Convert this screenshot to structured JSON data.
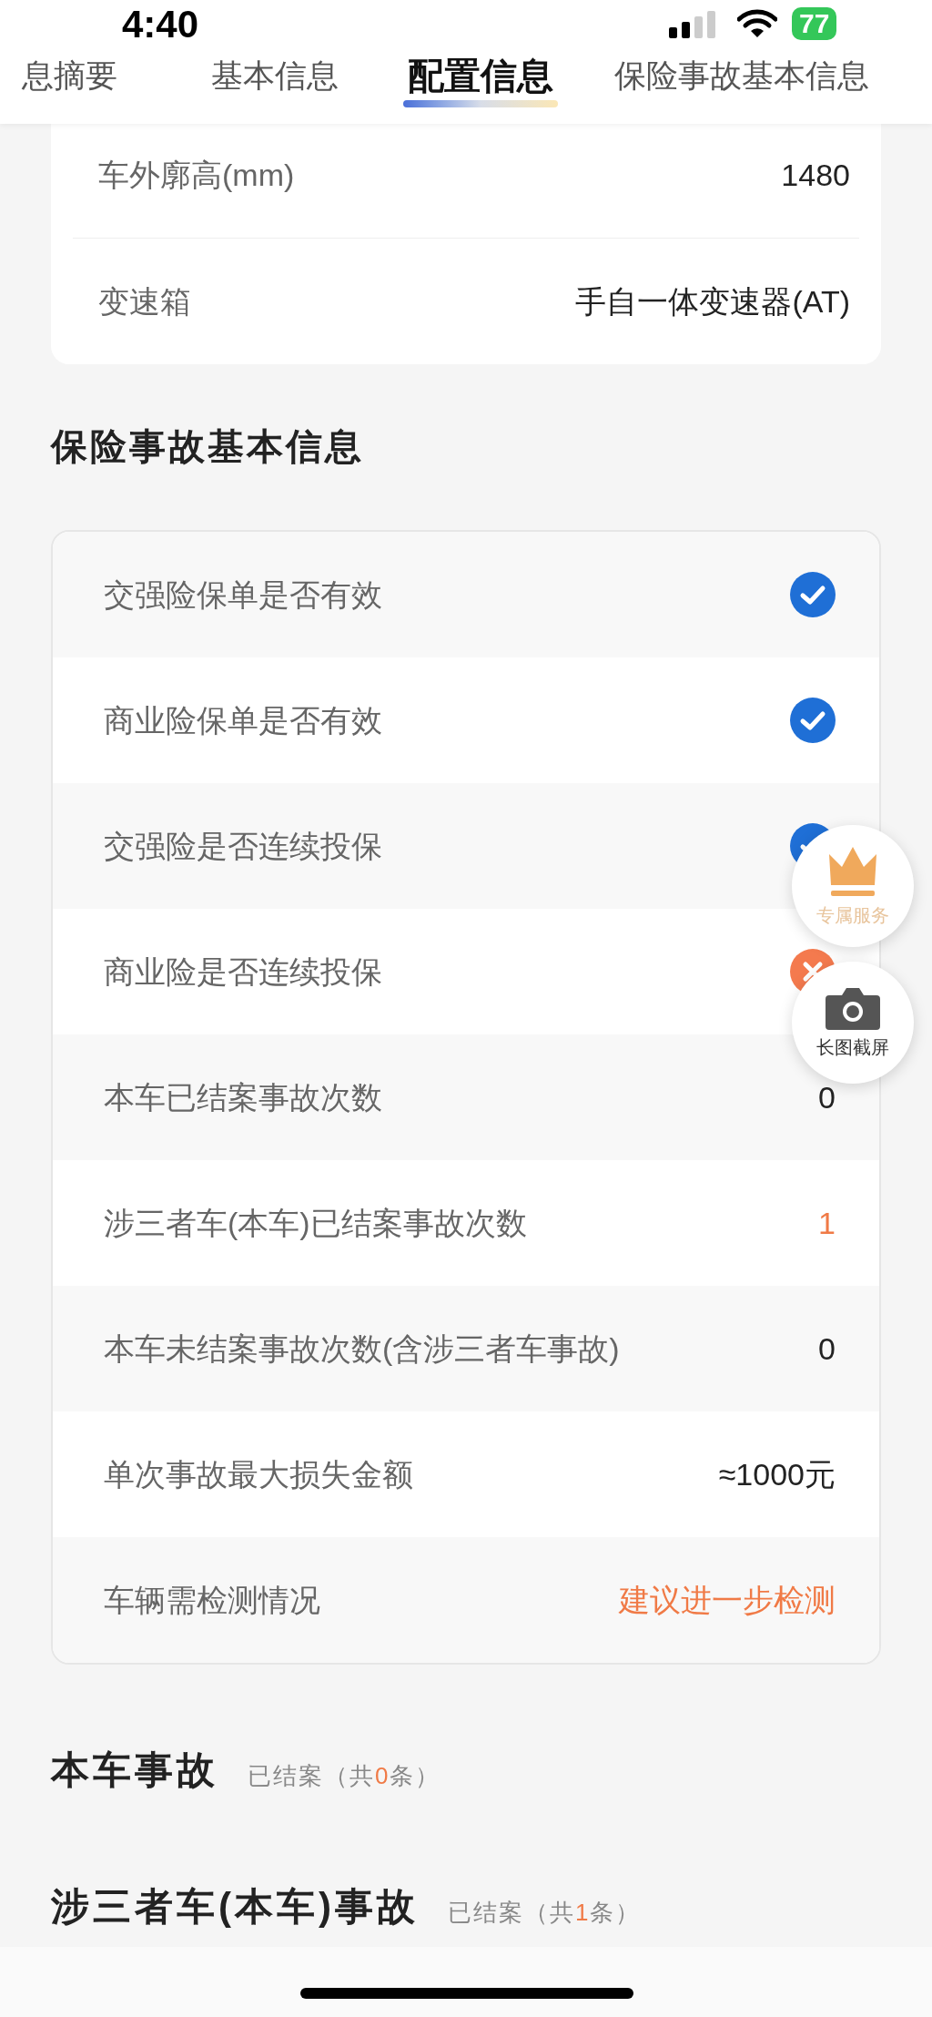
{
  "status_bar": {
    "time": "4:40",
    "battery": "77"
  },
  "tabs": [
    {
      "label": "息摘要",
      "selected": false
    },
    {
      "label": "基本信息",
      "selected": false
    },
    {
      "label": "配置信息",
      "selected": true
    },
    {
      "label": "保险事故基本信息",
      "selected": false
    }
  ],
  "config_rows": [
    {
      "label": "车外廓高(mm)",
      "value": "1480"
    },
    {
      "label": "变速箱",
      "value": "手自一体变速器(AT)"
    }
  ],
  "insurance_section": {
    "title": "保险事故基本信息",
    "rows": [
      {
        "label": "交强险保单是否有效",
        "kind": "check",
        "checked": true
      },
      {
        "label": "商业险保单是否有效",
        "kind": "check",
        "checked": true
      },
      {
        "label": "交强险是否连续投保",
        "kind": "check",
        "checked": true
      },
      {
        "label": "商业险是否连续投保",
        "kind": "check",
        "checked": false
      },
      {
        "label": "本车已结案事故次数",
        "kind": "text",
        "value": "0",
        "highlight": false
      },
      {
        "label": "涉三者车(本车)已结案事故次数",
        "kind": "text",
        "value": "1",
        "highlight": true
      },
      {
        "label": "本车未结案事故次数(含涉三者车事故)",
        "kind": "text",
        "value": "0",
        "highlight": false
      },
      {
        "label": "单次事故最大损失金额",
        "kind": "text",
        "value": "≈1000元",
        "highlight": false
      },
      {
        "label": "车辆需检测情况",
        "kind": "text",
        "value": "建议进一步检测",
        "highlight": true
      }
    ]
  },
  "floating_buttons": [
    {
      "kind": "crown",
      "label": "专属服务"
    },
    {
      "kind": "camera",
      "label": "长图截屏"
    }
  ],
  "accident_sections": [
    {
      "title": "本车事故",
      "before": "已结案（共",
      "count": "0",
      "after": "条）"
    },
    {
      "title": "涉三者车(本车)事故",
      "before": "已结案（共",
      "count": "1",
      "after": "条）"
    }
  ]
}
